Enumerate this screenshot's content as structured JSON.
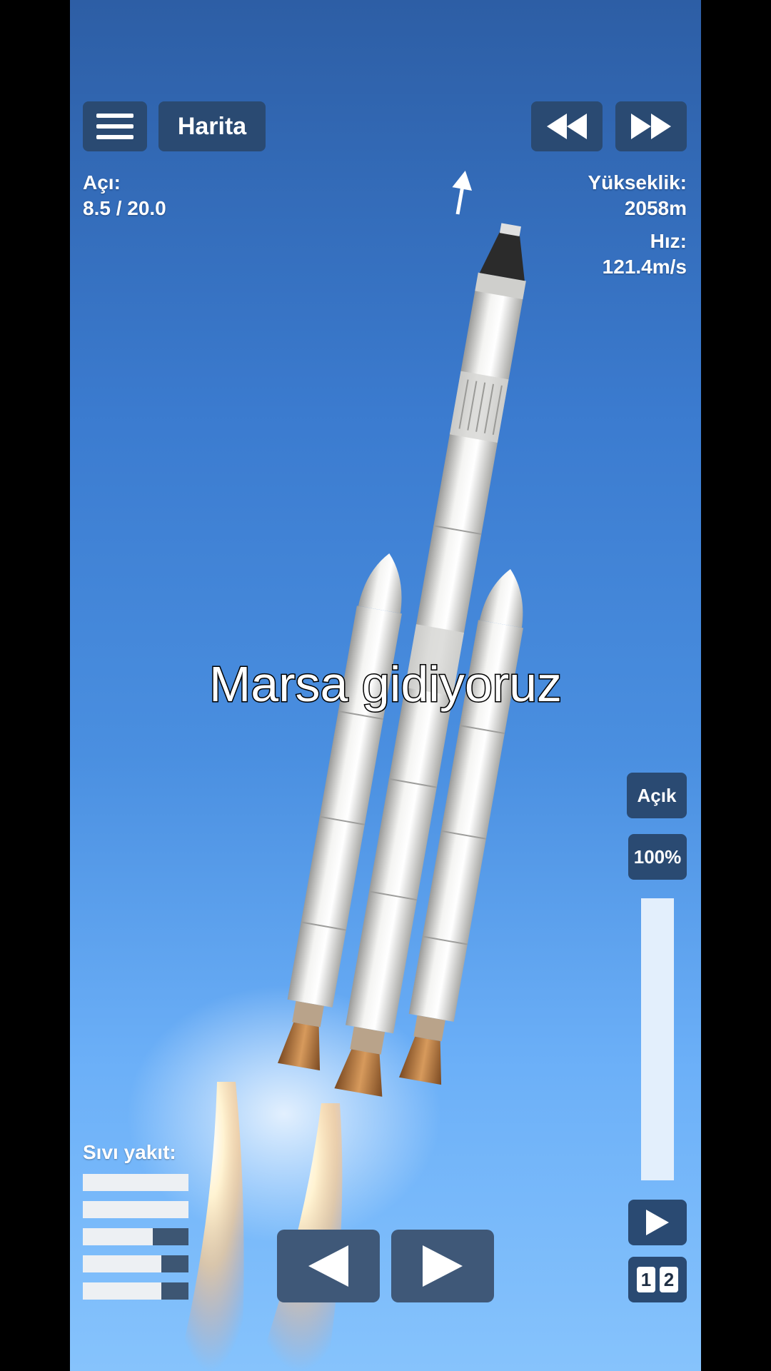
{
  "top_bar": {
    "map_label": "Harita",
    "menu_icon": "hamburger-icon",
    "rewind_icon": "rewind-icon",
    "fast_forward_icon": "fast-forward-icon"
  },
  "angle": {
    "label": "Açı:",
    "value": "8.5 / 20.0"
  },
  "altitude": {
    "label": "Yükseklik:",
    "value": "2058m"
  },
  "speed": {
    "label": "Hız:",
    "value": "121.4m/s"
  },
  "caption": "Marsa gidiyoruz",
  "throttle": {
    "toggle_label": "Açık",
    "percent_label": "100%",
    "level": 1.0
  },
  "fuel": {
    "label": "Sıvı yakıt:",
    "tanks": [
      {
        "fill_fraction": 0.0
      },
      {
        "fill_fraction": 0.0
      },
      {
        "fill_fraction": 0.34
      },
      {
        "fill_fraction": 0.26
      },
      {
        "fill_fraction": 0.26
      }
    ]
  },
  "controls": {
    "rotate_left_icon": "triangle-left-icon",
    "rotate_right_icon": "triangle-right-icon",
    "stage_icon": "play-icon",
    "stage_numbers": [
      "1",
      "2"
    ]
  },
  "colors": {
    "button_bg": "#2a4a72",
    "fuel_fill": "#3d5673",
    "fuel_empty": "#edf0f3"
  }
}
